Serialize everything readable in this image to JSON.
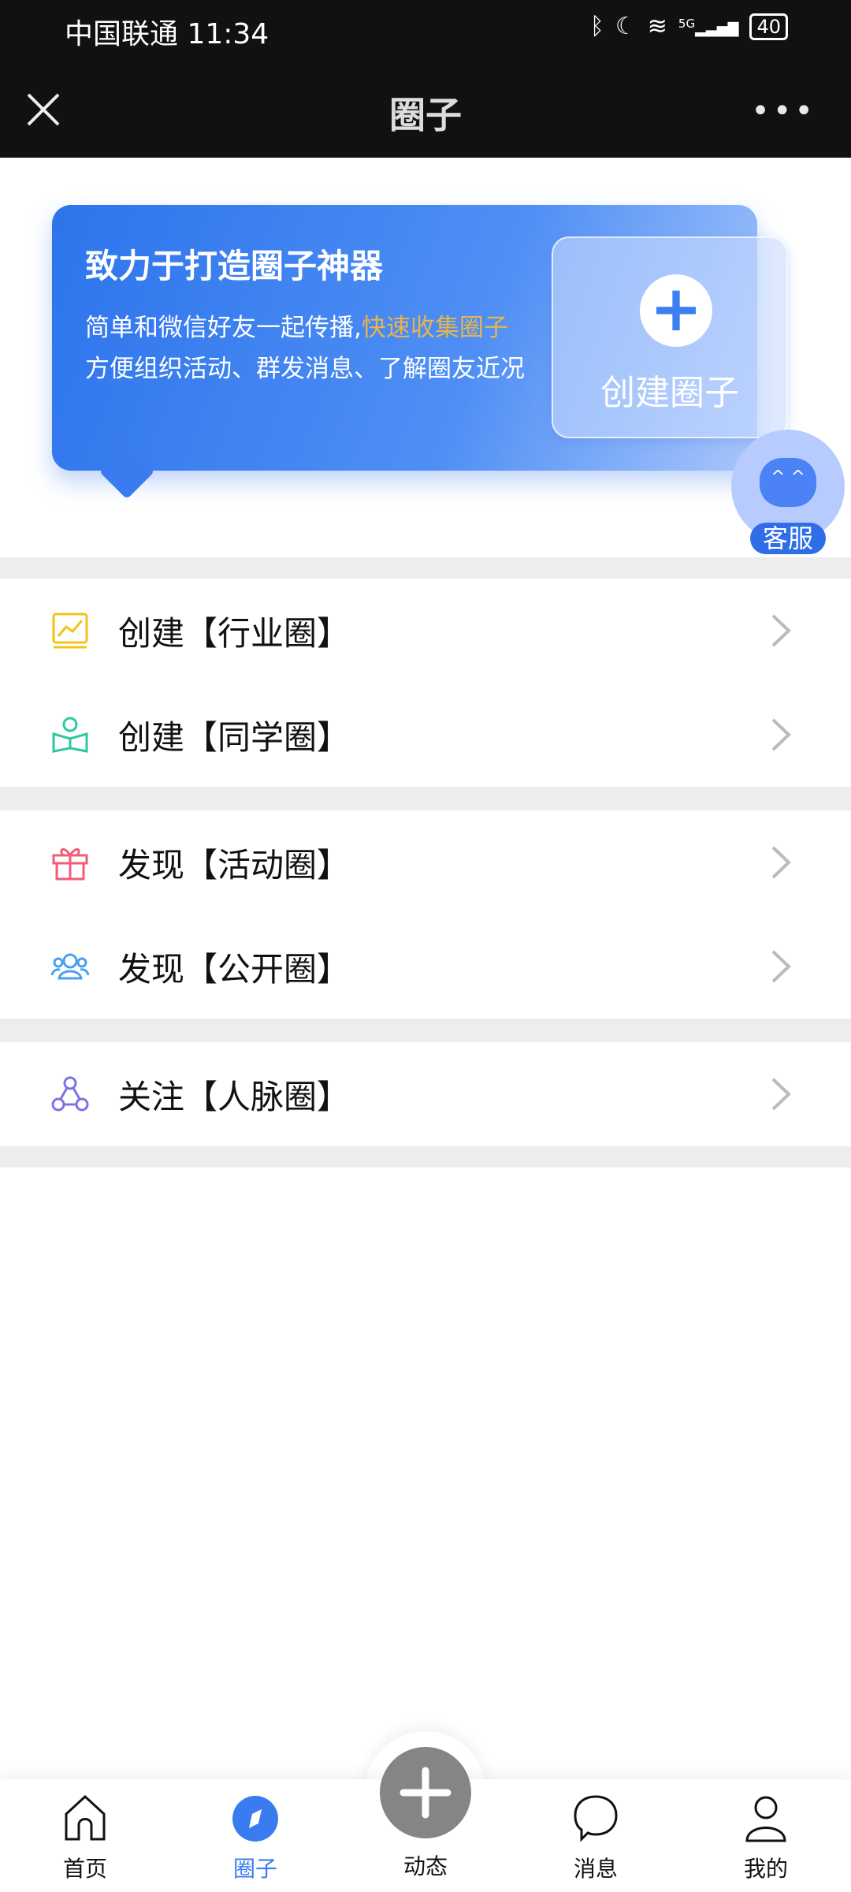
{
  "status_bar": {
    "carrier": "中国联通",
    "time": "11:34",
    "battery": "40",
    "network": "5G"
  },
  "nav": {
    "title": "圈子"
  },
  "banner": {
    "title": "致力于打造圈子神器",
    "desc_part1": "简单和微信好友一起传播,",
    "desc_highlight": "快速收集圈子",
    "desc_part2": "方便组织活动、群发消息、了解圈友近况",
    "create_label": "创建圈子",
    "highlight_color": "#e8b44c",
    "accent": "#2d74ec"
  },
  "service": {
    "label": "客服"
  },
  "menu": [
    {
      "label": "创建【行业圈】",
      "icon": "chart-icon",
      "color": "#f2c318"
    },
    {
      "label": "创建【同学圈】",
      "icon": "book-reader-icon",
      "color": "#2dc7a0"
    },
    {
      "label": "发现【活动圈】",
      "icon": "gift-icon",
      "color": "#ef5d78"
    },
    {
      "label": "发现【公开圈】",
      "icon": "group-icon",
      "color": "#4a9ff0"
    },
    {
      "label": "关注【人脉圈】",
      "icon": "network-icon",
      "color": "#7c74e6"
    }
  ],
  "tabs": [
    {
      "label": "首页",
      "icon": "home-icon"
    },
    {
      "label": "圈子",
      "icon": "compass-icon",
      "active": true,
      "color": "#3a7cf0"
    },
    {
      "label": "动态",
      "icon": "plus-icon"
    },
    {
      "label": "消息",
      "icon": "chat-icon"
    },
    {
      "label": "我的",
      "icon": "user-icon"
    }
  ]
}
